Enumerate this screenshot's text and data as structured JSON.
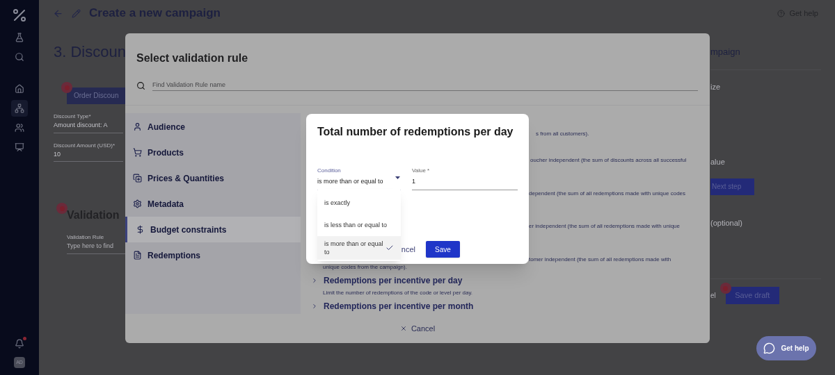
{
  "sidebar": {
    "items": [
      {
        "kind": "flask",
        "selected": false
      },
      {
        "kind": "search",
        "selected": false
      },
      {
        "kind": "home",
        "selected": false
      },
      {
        "kind": "tree",
        "selected": true
      },
      {
        "kind": "people",
        "selected": false
      },
      {
        "kind": "board",
        "selected": false
      }
    ],
    "notifications": {
      "unread": true
    },
    "avatar": "AD"
  },
  "header": {
    "title": "Create a new campaign",
    "help": "Get help"
  },
  "background": {
    "step_title": "3. Discoun",
    "order_button": "Order Discoun",
    "fields": [
      {
        "label": "Discount Type*",
        "value": "Amount discount: A"
      },
      {
        "label": "Discount Amount (USD)*",
        "value": "10"
      }
    ],
    "validation_title": "Validation",
    "validation_field": {
      "label": "Validation Rule",
      "placeholder": "Type here to find"
    },
    "side_title": "mpaign",
    "side_texts": [
      "ize",
      "alue"
    ],
    "next_button": "Next step",
    "optional": "(optional)",
    "cancel_fragment": "el",
    "save_draft": "Save draft"
  },
  "rule_dialog": {
    "title": "Select validation rule",
    "search_placeholder": "Find Validation Rule name",
    "categories": [
      {
        "label": "Audience",
        "kind": "person",
        "selected": false
      },
      {
        "label": "Products",
        "kind": "cart",
        "selected": false
      },
      {
        "label": "Prices & Quantities",
        "kind": "add",
        "selected": false
      },
      {
        "label": "Metadata",
        "kind": "gear",
        "selected": false
      },
      {
        "label": "Budget constraints",
        "kind": "dollar",
        "selected": true
      },
      {
        "label": "Redemptions",
        "kind": "list",
        "selected": false
      }
    ],
    "fragments": [
      "s from all customers).",
      "oucher independent (the sum of discounts across all successful",
      "dependent (the sum of all redemptions made with unique codes",
      "er independent (the sum of all redemptions made with unique",
      "tomer independent (the sum of all redemptions made with"
    ],
    "continuation": "unique codes from the campaign).",
    "rules": [
      {
        "title": "Redemptions per incentive per day",
        "description": "Limit the number of redemptions of the code or level per day."
      },
      {
        "title": "Redemptions per incentive per month"
      }
    ],
    "cancel": "Cancel"
  },
  "condition_dialog": {
    "title": "Total number of redemptions per day",
    "condition": {
      "label": "Condition",
      "value": "is more than or equal to",
      "expanded": true,
      "options": [
        {
          "label": "is exactly",
          "selected": false
        },
        {
          "label": "is less than or equal to",
          "selected": false
        },
        {
          "label": "is more than or equal to",
          "selected": true
        }
      ]
    },
    "value_field": {
      "label": "Value *",
      "value": "1"
    },
    "cancel": "ncel",
    "save": "Save"
  },
  "chat_button": "Get help"
}
